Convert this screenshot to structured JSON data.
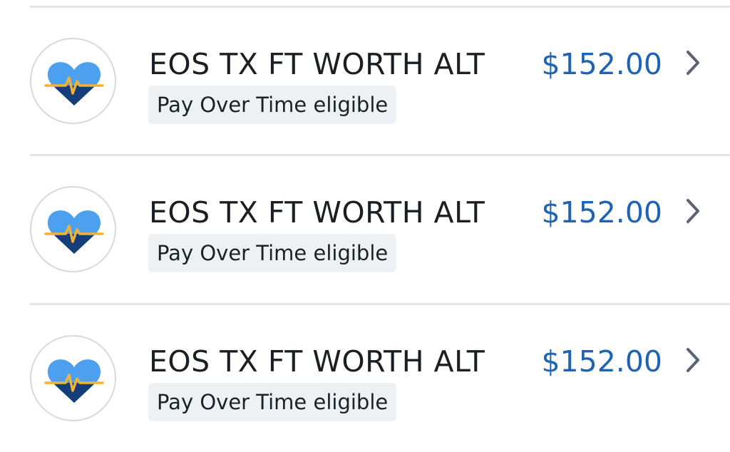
{
  "transactions": [
    {
      "merchant": "EOS TX FT WORTH ALT",
      "tag": "Pay Over Time eligible",
      "amount": "$152.00",
      "icon": "heart-pulse-icon"
    },
    {
      "merchant": "EOS TX FT WORTH ALT",
      "tag": "Pay Over Time eligible",
      "amount": "$152.00",
      "icon": "heart-pulse-icon"
    },
    {
      "merchant": "EOS TX FT WORTH ALT",
      "tag": "Pay Over Time eligible",
      "amount": "$152.00",
      "icon": "heart-pulse-icon"
    }
  ],
  "colors": {
    "amount": "#1f63b5",
    "heart_light": "#4d9ff0",
    "heart_dark": "#143e7a",
    "pulse_line": "#f2b233",
    "badge_bg": "#eef1f4",
    "divider": "#e1e4e8"
  }
}
